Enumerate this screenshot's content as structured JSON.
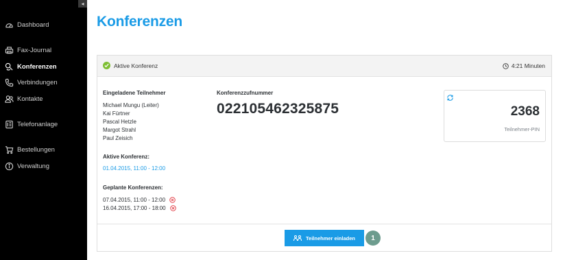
{
  "sidebar": {
    "items": [
      {
        "label": "Dashboard",
        "icon": "dashboard-icon",
        "active": false
      },
      {
        "label": "Fax-Journal",
        "icon": "fax-icon",
        "active": false
      },
      {
        "label": "Konferenzen",
        "icon": "conference-icon",
        "active": true
      },
      {
        "label": "Verbindungen",
        "icon": "phone-icon",
        "active": false
      },
      {
        "label": "Kontakte",
        "icon": "contacts-icon",
        "active": false
      },
      {
        "label": "Telefonanlage",
        "icon": "pbx-icon",
        "active": false
      },
      {
        "label": "Bestellungen",
        "icon": "cart-icon",
        "active": false
      },
      {
        "label": "Verwaltung",
        "icon": "info-icon",
        "active": false
      }
    ],
    "collapse_glyph": "◂"
  },
  "page": {
    "title": "Konferenzen"
  },
  "conference": {
    "status_label": "Aktive Konferenz",
    "duration": "4:21 Minuten",
    "invited_heading": "Eingeladene Teilnehmer",
    "participants": [
      "Michael Mungu (Leiter)",
      "Kai Fürtner",
      "Pascal Hetzle",
      "Margot Strahl",
      "Paul Zeisich"
    ],
    "active_heading": "Aktive Konferenz:",
    "active_date": "01.04.2015, 11:00 - 12:00",
    "planned_heading": "Geplante Konferenzen:",
    "planned": [
      "07.04.2015, 11:00 - 12:00",
      "16.04.2015, 17:00 - 18:00"
    ],
    "number_heading": "Konferenzzufnummer",
    "number": "022105462325875",
    "pin": "2368",
    "pin_label": "Teilnehmer-PIN",
    "invite_label": "Teilnehmer einladen",
    "step": "1"
  },
  "colors": {
    "accent": "#1a9be6",
    "sidebar_bg": "#000000",
    "status_green": "#7fbf34",
    "delete_red": "#e0303a",
    "step_badge": "#6d9c8e"
  }
}
